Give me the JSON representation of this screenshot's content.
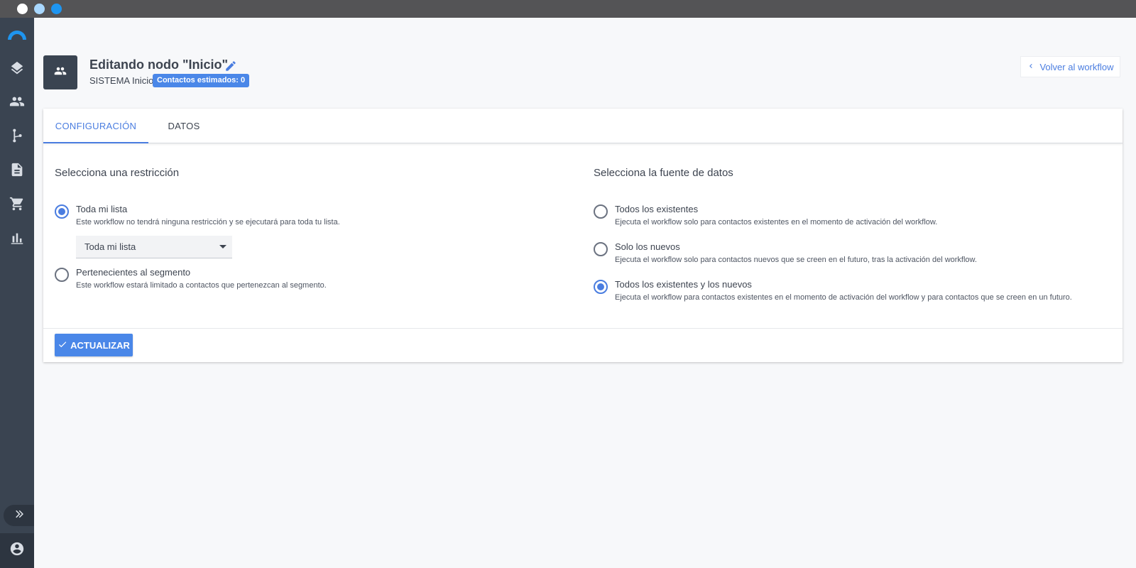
{
  "window": {
    "controls": [
      "close",
      "minimize",
      "maximize"
    ]
  },
  "sidebar": {
    "items": [
      {
        "icon": "logo-icon"
      },
      {
        "icon": "layers-icon"
      },
      {
        "icon": "people-icon"
      },
      {
        "icon": "workflow-icon"
      },
      {
        "icon": "document-icon"
      },
      {
        "icon": "cart-icon"
      },
      {
        "icon": "bar-chart-icon"
      }
    ],
    "expand_icon": "double-chevron-right-icon",
    "user_icon": "account-circle-icon"
  },
  "header": {
    "title": "Editando nodo \"Inicio\"",
    "subtitle": "SISTEMA Inicio",
    "badge": "Contactos estimados: 0",
    "back_label": "Volver al workflow"
  },
  "tabs": [
    {
      "label": "CONFIGURACIÓN",
      "active": true
    },
    {
      "label": "DATOS",
      "active": false
    }
  ],
  "restriction": {
    "title": "Selecciona una restricción",
    "options": [
      {
        "label": "Toda mi lista",
        "description": "Este workflow no tendrá ninguna restricción y se ejecutará para toda tu lista.",
        "checked": true
      },
      {
        "label": "Pertenecientes al segmento",
        "description": "Este workflow estará limitado a contactos que pertenezcan al segmento.",
        "checked": false
      }
    ],
    "select_value": "Toda mi lista"
  },
  "source": {
    "title": "Selecciona la fuente de datos",
    "options": [
      {
        "label": "Todos los existentes",
        "description": "Ejecuta el workflow solo para contactos existentes en el momento de activación del workflow.",
        "checked": false
      },
      {
        "label": "Solo los nuevos",
        "description": "Ejecuta el workflow solo para contactos nuevos que se creen en el futuro, tras la activación del workflow.",
        "checked": false
      },
      {
        "label": "Todos los existentes y los nuevos",
        "description": "Ejecuta el workflow para contactos existentes en el momento de activación del workflow y para contactos que se creen en un futuro.",
        "checked": true
      }
    ]
  },
  "actions": {
    "update_label": "ACTUALIZAR"
  },
  "colors": {
    "accent": "#4a7de0",
    "sidebar": "#3a4451",
    "titlebar": "#545456",
    "background": "#f7f8fa"
  }
}
